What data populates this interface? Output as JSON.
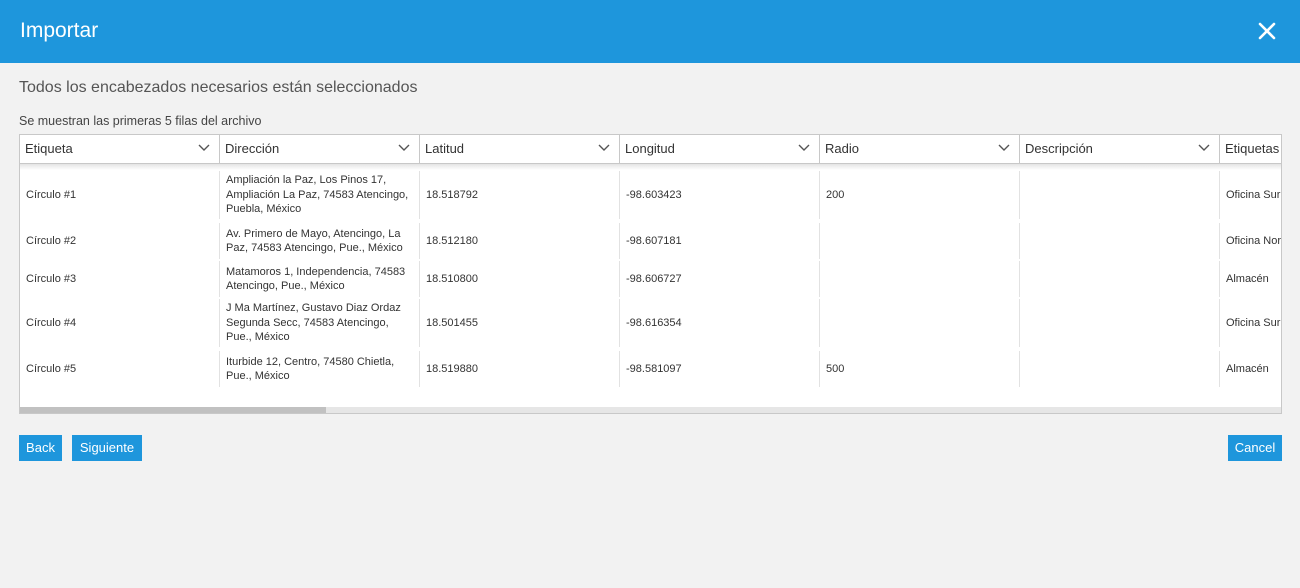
{
  "dialog": {
    "title": "Importar"
  },
  "status_text": "Todos los encabezados necesarios están seleccionados",
  "rows_caption": "Se muestran las primeras 5 filas del archivo",
  "columns": [
    "Etiqueta",
    "Dirección",
    "Latitud",
    "Longitud",
    "Radio",
    "Descripción",
    "Etiquetas"
  ],
  "rows": [
    [
      "Círculo #1",
      "Ampliación la Paz, Los Pinos 17, Ampliación La Paz, 74583 Atencingo, Puebla, México",
      "18.518792",
      "-98.603423",
      "200",
      "",
      "Oficina Sur"
    ],
    [
      "Círculo #2",
      "Av. Primero de Mayo, Atencingo, La Paz, 74583 Atencingo, Pue., México",
      "18.512180",
      "-98.607181",
      "",
      "",
      "Oficina Norte"
    ],
    [
      "Círculo #3",
      "Matamoros 1, Independencia, 74583 Atencingo, Pue., México",
      "18.510800",
      "-98.606727",
      "",
      "",
      "Almacén"
    ],
    [
      "Círculo #4",
      "J Ma Martínez, Gustavo Diaz Ordaz Segunda Secc, 74583 Atencingo, Pue., México",
      "18.501455",
      "-98.616354",
      "",
      "",
      "Oficina Sur"
    ],
    [
      "Círculo #5",
      "Iturbide 12, Centro, 74580 Chietla, Pue., México",
      "18.519880",
      "-98.581097",
      "500",
      "",
      "Almacén"
    ]
  ],
  "buttons": {
    "back": "Back",
    "next": "Siguiente",
    "cancel": "Cancel"
  },
  "icons": {
    "close": "close-icon",
    "header_dropdown": "chevron-down-icon"
  },
  "colors": {
    "primary": "#1e96dc",
    "background": "#f2f2f2"
  }
}
